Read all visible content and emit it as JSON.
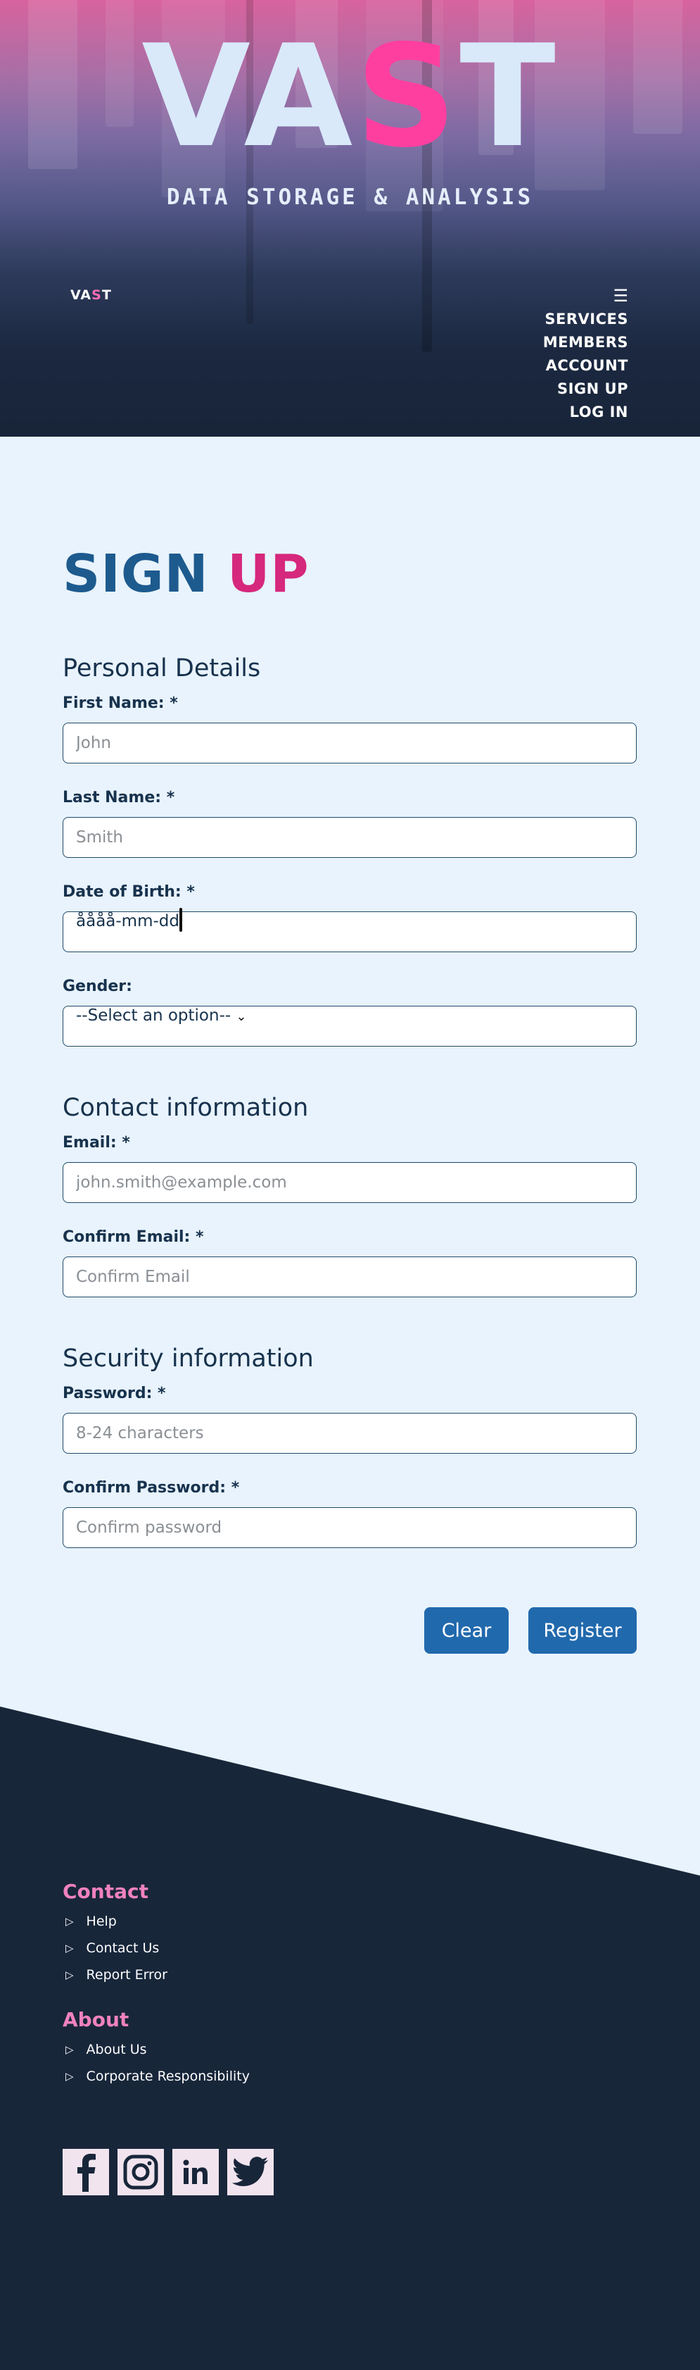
{
  "hero": {
    "title_pre": "VA",
    "title_accent": "S",
    "title_post": "T",
    "subtitle": "DATA STORAGE & ANALYSIS"
  },
  "brand": {
    "pre": "VA",
    "accent": "S",
    "post": "T"
  },
  "nav": {
    "menu_icon": "hamburger-icon",
    "menu_glyph": "☰",
    "items": [
      "SERVICES",
      "MEMBERS",
      "ACCOUNT",
      "SIGN UP",
      "LOG IN"
    ]
  },
  "page": {
    "title_main": "SIGN",
    "title_accent": "UP"
  },
  "sections": {
    "personal": "Personal Details",
    "contact": "Contact information",
    "security": "Security information"
  },
  "fields": {
    "first_name": {
      "label": "First Name: *",
      "placeholder": "John"
    },
    "last_name": {
      "label": "Last Name: *",
      "placeholder": "Smith"
    },
    "dob": {
      "label": "Date of Birth: *",
      "value": "åååå-mm-dd"
    },
    "gender": {
      "label": "Gender:",
      "selected": "--Select an option--"
    },
    "email": {
      "label": "Email: *",
      "placeholder": "john.smith@example.com"
    },
    "confirm_email": {
      "label": "Confirm Email: *",
      "placeholder": "Confirm Email"
    },
    "password": {
      "label": "Password: *",
      "placeholder": "8-24 characters"
    },
    "confirm_password": {
      "label": "Confirm Password: *",
      "placeholder": "Confirm password"
    }
  },
  "buttons": {
    "clear": "Clear",
    "register": "Register"
  },
  "footer": {
    "contact_head": "Contact",
    "contact_items": [
      "Help",
      "Contact Us",
      "Report Error"
    ],
    "about_head": "About",
    "about_items": [
      "About Us",
      "Corporate Responsibility"
    ],
    "bullet_glyph": "▷",
    "social_icons": [
      "facebook-icon",
      "instagram-icon",
      "linkedin-icon",
      "twitter-icon"
    ]
  },
  "colors": {
    "accent_pink": "#ff3fa0",
    "title_blue": "#1d5a8e",
    "title_pink": "#d6287c",
    "button_blue": "#2169ad",
    "footer_bg": "#18263a",
    "page_bg": "#e8f3fd",
    "footer_head_pink": "#f082be"
  }
}
